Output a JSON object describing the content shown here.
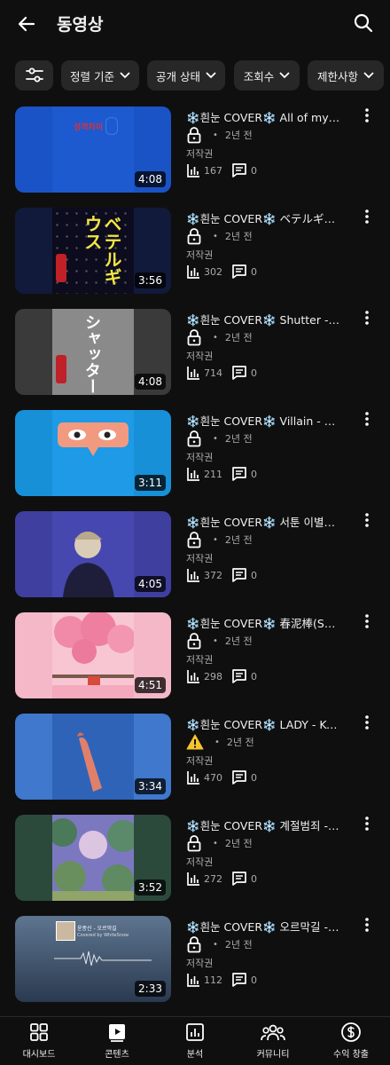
{
  "header": {
    "title": "동영상"
  },
  "chips": [
    {
      "label": "정렬 기준"
    },
    {
      "label": "공개 상태"
    },
    {
      "label": "조회수"
    },
    {
      "label": "제한사항"
    }
  ],
  "videos": [
    {
      "title": "❄️흰눈 COVER❄️ All of my life - 박원",
      "duration": "4:08",
      "age": "2년 전",
      "copyright": "저작권",
      "views": "167",
      "comments": "0",
      "status_icon": "lock-icon"
    },
    {
      "title": "❄️흰눈 COVER❄️ ベテルギウス(베텔기우스)",
      "duration": "3:56",
      "age": "2년 전",
      "copyright": "저작권",
      "views": "302",
      "comments": "0",
      "status_icon": "lock-icon"
    },
    {
      "title": "❄️흰눈 COVER❄️ Shutter - 優里",
      "duration": "4:08",
      "age": "2년 전",
      "copyright": "저작권",
      "views": "714",
      "comments": "0",
      "status_icon": "lock-icon"
    },
    {
      "title": "❄️흰눈 COVER❄️ Villain - 스텔라장",
      "duration": "3:11",
      "age": "2년 전",
      "copyright": "저작권",
      "views": "211",
      "comments": "0",
      "status_icon": "lock-icon"
    },
    {
      "title": "❄️흰눈 COVER❄️ 서툰 이별을 하려해",
      "duration": "4:05",
      "age": "2년 전",
      "copyright": "저작권",
      "views": "372",
      "comments": "0",
      "status_icon": "lock-icon"
    },
    {
      "title": "❄️흰눈 COVER❄️ 春泥棒(Spring Thief)",
      "duration": "4:51",
      "age": "2년 전",
      "copyright": "저작권",
      "views": "298",
      "comments": "0",
      "status_icon": "lock-icon"
    },
    {
      "title": "❄️흰눈 COVER❄️ LADY - Kenshi Yonezu",
      "duration": "3:34",
      "age": "2년 전",
      "copyright": "저작권",
      "views": "470",
      "comments": "0",
      "status_icon": "warning-icon"
    },
    {
      "title": "❄️흰눈 COVER❄️ 계절범죄 - Miina",
      "duration": "3:52",
      "age": "2년 전",
      "copyright": "저작권",
      "views": "272",
      "comments": "0",
      "status_icon": "lock-icon"
    },
    {
      "title": "❄️흰눈 COVER❄️ 오르막길 - 윤종신",
      "duration": "2:33",
      "age": "2년 전",
      "copyright": "저작권",
      "views": "112",
      "comments": "0",
      "status_icon": "lock-icon"
    }
  ],
  "thumbs": {
    "t1": "성격차이",
    "t2": "ベテルギウス",
    "t3": "シャッター",
    "t9a": "윤종신 - 오르막길",
    "t9b": "Covered by WhiteSnow"
  },
  "bottom_nav": [
    {
      "label": "대시보드",
      "icon": "dashboard-icon"
    },
    {
      "label": "콘텐츠",
      "icon": "content-icon"
    },
    {
      "label": "분석",
      "icon": "analytics-icon"
    },
    {
      "label": "커뮤니티",
      "icon": "community-icon"
    },
    {
      "label": "수익 창출",
      "icon": "monetization-icon"
    }
  ],
  "colors": {
    "background": "#0f0f0f",
    "chip": "#272727",
    "secondary_text": "#aaaaaa",
    "warning": "#f4c430"
  }
}
